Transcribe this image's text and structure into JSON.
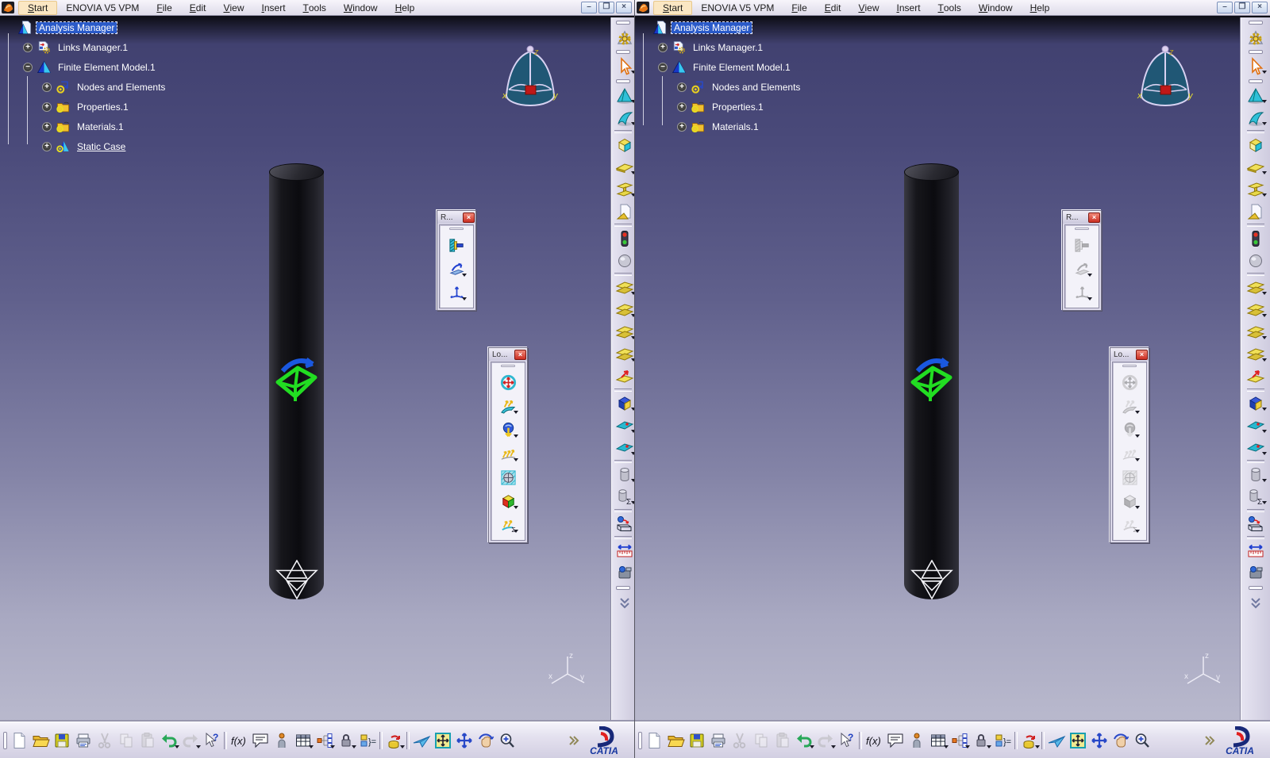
{
  "colors": {
    "selection_blue": "#2a5ac8",
    "viewport_top": "#414170",
    "viewport_bottom": "#b9b9cd",
    "toolbar_lavender": "#dddaeb",
    "close_button_red": "#cc2f23",
    "compass_red": "#c01818",
    "clamp_green": "#22dd22",
    "start_highlight": "#fbe7c3"
  },
  "menu_bar": {
    "items": [
      {
        "k": "S",
        "rest": "tart",
        "highlight": true
      },
      {
        "k": "",
        "rest": "ENOVIA V5 VPM"
      },
      {
        "k": "F",
        "rest": "ile"
      },
      {
        "k": "E",
        "rest": "dit"
      },
      {
        "k": "V",
        "rest": "iew"
      },
      {
        "k": "I",
        "rest": "nsert"
      },
      {
        "k": "T",
        "rest": "ools"
      },
      {
        "k": "W",
        "rest": "indow"
      },
      {
        "k": "H",
        "rest": "elp"
      }
    ],
    "window_controls": [
      {
        "glyph": "–",
        "name": "minimize-button"
      },
      {
        "glyph": "❐",
        "name": "restore-button"
      },
      {
        "glyph": "×",
        "name": "close-button"
      }
    ]
  },
  "floating": {
    "close_glyph": "×",
    "restraints": {
      "title": "R...",
      "items": [
        {
          "icon": "i-clamp-icon"
        },
        {
          "icon": "i-surface-slider-icon",
          "dd": true
        },
        {
          "icon": "i-advanced-restraint-icon",
          "dd": true
        }
      ]
    },
    "loads": {
      "title": "Lo...",
      "items": [
        {
          "icon": "i-pressure-icon"
        },
        {
          "icon": "i-distributed-force-icon",
          "dd": true
        },
        {
          "icon": "i-acceleration-icon",
          "dd": true
        },
        {
          "icon": "i-line-force-icon",
          "dd": true
        },
        {
          "icon": "i-bearing-load-icon"
        },
        {
          "icon": "i-volume-force-icon",
          "dd": true
        },
        {
          "icon": "i-force-sigma-icon",
          "dd": true
        }
      ]
    }
  },
  "right_toolbar": {
    "items": [
      {
        "type": "grip"
      },
      {
        "type": "btn",
        "icon": "i-compute-icon"
      },
      {
        "type": "grip"
      },
      {
        "type": "btn",
        "icon": "i-select-icon",
        "dd": true
      },
      {
        "type": "grip"
      },
      {
        "type": "btn",
        "icon": "i-tet-mesher-icon",
        "dd": true
      },
      {
        "type": "btn",
        "icon": "i-surface-mesher-icon",
        "dd": true
      },
      {
        "type": "sep"
      },
      {
        "type": "btn",
        "icon": "i-solid-property-icon"
      },
      {
        "type": "btn",
        "icon": "i-shell-property-icon",
        "dd": true
      },
      {
        "type": "btn",
        "icon": "i-beam-property-icon",
        "dd": true
      },
      {
        "type": "btn",
        "icon": "i-user-material-icon"
      },
      {
        "type": "sep"
      },
      {
        "type": "btn",
        "icon": "i-model-checker-icon"
      },
      {
        "type": "btn",
        "icon": "i-mass-sphere-icon"
      },
      {
        "type": "sep"
      },
      {
        "type": "btn",
        "icon": "i-stacked-planes-icon",
        "dd": true
      },
      {
        "type": "btn",
        "icon": "i-stacked-planes-icon",
        "dd": true
      },
      {
        "type": "btn",
        "icon": "i-stacked-planes-icon",
        "dd": true
      },
      {
        "type": "btn",
        "icon": "i-stacked-planes-icon",
        "dd": true
      },
      {
        "type": "btn",
        "icon": "i-plane-arrow-icon"
      },
      {
        "type": "sep"
      },
      {
        "type": "btn",
        "icon": "i-blue-box-icon",
        "dd": true
      },
      {
        "type": "btn",
        "icon": "i-mesh-view-icon",
        "dd": true
      },
      {
        "type": "btn",
        "icon": "i-mesh-view-icon",
        "dd": true
      },
      {
        "type": "sep"
      },
      {
        "type": "btn",
        "icon": "i-cylinder-mass-icon",
        "dd": true
      },
      {
        "type": "btn",
        "icon": "i-cylinder-sigma-icon",
        "dd": true
      },
      {
        "type": "sep"
      },
      {
        "type": "btn",
        "icon": "i-external-storage-icon"
      },
      {
        "type": "sep"
      },
      {
        "type": "btn",
        "icon": "i-measure-icon"
      },
      {
        "type": "btn",
        "icon": "i-measure-item-icon"
      },
      {
        "type": "grip"
      },
      {
        "type": "btn",
        "icon": "i-more-chevron-icon"
      }
    ]
  },
  "bottom_toolbar": {
    "items": [
      {
        "type": "grip"
      },
      {
        "type": "btn",
        "icon": "i-new-icon"
      },
      {
        "type": "btn",
        "icon": "i-open-icon"
      },
      {
        "type": "btn",
        "icon": "i-save-icon"
      },
      {
        "type": "btn",
        "icon": "i-print-icon"
      },
      {
        "type": "btn",
        "icon": "i-cut-icon",
        "disabled": true
      },
      {
        "type": "btn",
        "icon": "i-copy-icon",
        "disabled": true
      },
      {
        "type": "btn",
        "icon": "i-paste-icon",
        "disabled": true
      },
      {
        "type": "btn",
        "icon": "i-undo-icon",
        "dd": true
      },
      {
        "type": "btn",
        "icon": "i-redo-icon",
        "dd": true,
        "disabled": true
      },
      {
        "type": "btn",
        "icon": "i-whats-this-icon"
      },
      {
        "type": "sep"
      },
      {
        "type": "btn",
        "icon": "i-formula-icon"
      },
      {
        "type": "btn",
        "icon": "i-comment-icon"
      },
      {
        "type": "btn",
        "icon": "i-manikin-icon"
      },
      {
        "type": "btn",
        "icon": "i-design-table-icon",
        "dd": true
      },
      {
        "type": "btn",
        "icon": "i-network-icon",
        "dd": true
      },
      {
        "type": "btn",
        "icon": "i-lock-icon",
        "dd": true
      },
      {
        "type": "btn",
        "icon": "i-rules-icon"
      },
      {
        "type": "sep"
      },
      {
        "type": "btn",
        "icon": "i-catalog-icon",
        "dd": true
      },
      {
        "type": "sep"
      },
      {
        "type": "btn",
        "icon": "i-fly-icon"
      },
      {
        "type": "btn",
        "icon": "i-fit-all-icon"
      },
      {
        "type": "btn",
        "icon": "i-pan-icon"
      },
      {
        "type": "btn",
        "icon": "i-rotate-icon"
      },
      {
        "type": "btn",
        "icon": "i-zoom-in-icon"
      },
      {
        "type": "btn",
        "icon": "i-overflow-chevron-icon",
        "push": true
      }
    ]
  },
  "compass": {
    "x": "x",
    "y": "y",
    "z": "z"
  },
  "axis_triad": {
    "x": "x",
    "y": "y",
    "z": "z"
  },
  "logo": {
    "brand": "CATIA"
  },
  "windows": [
    {
      "side": "left",
      "floats_disabled": false,
      "tree": [
        {
          "label": "Analysis Manager",
          "icon": "i-analysis-manager-icon",
          "depth": 0,
          "selected": true
        },
        {
          "label": "Links Manager.1",
          "icon": "i-links-manager-icon",
          "depth": 1,
          "expander": "+"
        },
        {
          "label": "Finite Element Model.1",
          "icon": "i-fem-model-icon",
          "depth": 1,
          "expander": "−"
        },
        {
          "label": "Nodes and Elements",
          "icon": "i-nodes-elements-icon",
          "depth": 2,
          "expander": "+"
        },
        {
          "label": "Properties.1",
          "icon": "i-properties-icon",
          "depth": 2,
          "expander": "+"
        },
        {
          "label": "Materials.1",
          "icon": "i-properties-icon",
          "depth": 2,
          "expander": "+"
        },
        {
          "label": "Static Case",
          "icon": "i-static-case-icon",
          "depth": 2,
          "expander": "+",
          "underlined": true
        }
      ]
    },
    {
      "side": "right",
      "floats_disabled": true,
      "tree": [
        {
          "label": "Analysis Manager",
          "icon": "i-analysis-manager-icon",
          "depth": 0,
          "selected": true
        },
        {
          "label": "Links Manager.1",
          "icon": "i-links-manager-icon",
          "depth": 1,
          "expander": "+"
        },
        {
          "label": "Finite Element Model.1",
          "icon": "i-fem-model-icon",
          "depth": 1,
          "expander": "−"
        },
        {
          "label": "Nodes and Elements",
          "icon": "i-nodes-elements-icon",
          "depth": 2,
          "expander": "+"
        },
        {
          "label": "Properties.1",
          "icon": "i-properties-icon",
          "depth": 2,
          "expander": "+"
        },
        {
          "label": "Materials.1",
          "icon": "i-properties-icon",
          "depth": 2,
          "expander": "+"
        }
      ]
    }
  ]
}
